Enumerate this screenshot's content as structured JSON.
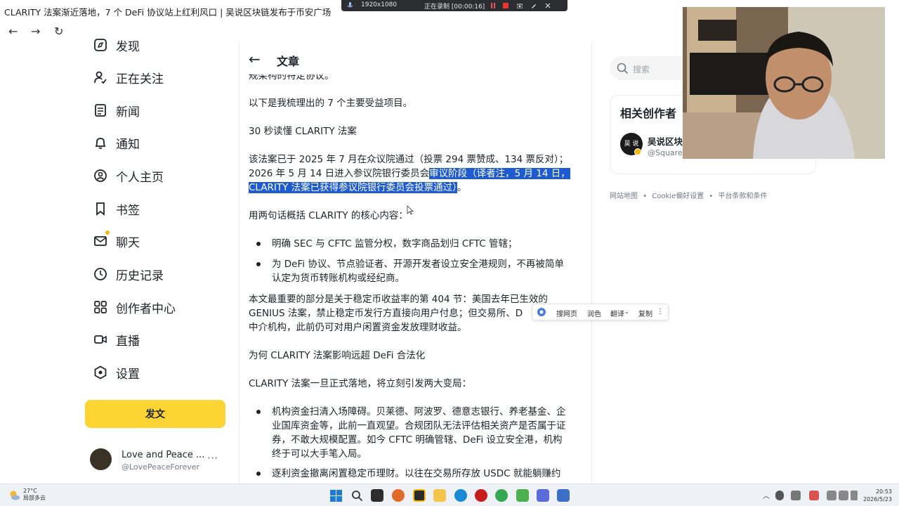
{
  "window": {
    "title": "CLARITY 法案渐近落地，7 个 DeFi 协议站上红利风口 | 吴说区块链发布于币安广场"
  },
  "recorder": {
    "resolution": "1920x1080",
    "status": "正在录制 [00:00:16]"
  },
  "sidebar": {
    "items": [
      {
        "label": "发现",
        "icon": "discover-icon"
      },
      {
        "label": "正在关注",
        "icon": "following-icon"
      },
      {
        "label": "新闻",
        "icon": "news-icon"
      },
      {
        "label": "通知",
        "icon": "bell-icon"
      },
      {
        "label": "个人主页",
        "icon": "profile-icon"
      },
      {
        "label": "书签",
        "icon": "bookmark-icon"
      },
      {
        "label": "聊天",
        "icon": "mail-icon"
      },
      {
        "label": "历史记录",
        "icon": "history-icon"
      },
      {
        "label": "创作者中心",
        "icon": "creator-center-icon"
      },
      {
        "label": "直播",
        "icon": "live-icon"
      },
      {
        "label": "设置",
        "icon": "settings-icon"
      }
    ],
    "post_button": "发文",
    "user": {
      "name": "Love and Peace ...",
      "handle": "@LovePeaceForever",
      "more": "···"
    }
  },
  "article": {
    "back": "←",
    "header_title": "文章",
    "cut_line": "规架构的特定协议。",
    "p1": "以下是我梳理出的 7 个主要受益项目。",
    "p2": "30 秒读懂 CLARITY 法案",
    "p3_line1": "该法案已于 2025 年 7 月在众议院通过（投票 294 票赞成、134 票反对）；",
    "p3_line2_plain": "2026 年 5 月 14 日进入参议院银行委员会",
    "p3_line2_hl": "审议阶段（译者注，5 月 14 日，",
    "p3_line3_hl": "CLARITY 法案已获得参议院银行委员会投票通过）",
    "p3_line3_end": "。",
    "p4": "用两句话概括 CLARITY 的核心内容：",
    "b1": "明确 SEC 与 CFTC 监管分权，数字商品划归 CFTC 管辖；",
    "b2_line1": "为 DeFi 协议、节点验证者、开源开发者设立安全港规则，不再被简单",
    "b2_line2": "认定为货币转账机构或经纪商。",
    "p5_line1": "本文最重要的部分是关于稳定币收益率的第 404 节：美国去年已生效的",
    "p5_line2": "GENIUS 法案，禁止稳定币发行方直接向用户付息；但交易所、D",
    "p5_line3": "中介机构，此前仍可对用户闲置资金发放理财收益。",
    "p6": "为何 CLARITY 法案影响远超 DeFi 合法化",
    "p7": "CLARITY 法案一旦正式落地，将立刻引发两大变局：",
    "b3_line1": "机构资金扫清入场障碍。贝莱德、阿波罗、德意志银行、养老基金、企",
    "b3_line2": "业国库资金等，此前一直观望。合规团队无法评估相关资产是否属于证",
    "b3_line3": "券，不敢大规模配置。如今 CFTC 明确管辖、DeFi 设立安全港，机构",
    "b3_line4": "终于可以大手笔入局。",
    "b4_line1": "逐利资金撤离闲置稳定币理财。以往在交易所存放 USDC 就能躺赚约"
  },
  "selection_popup": {
    "search": "搜网页",
    "polish": "润色",
    "translate": "翻译",
    "copy": "复制",
    "more": "⋮"
  },
  "right": {
    "search_placeholder": "搜索",
    "creators_title": "相关创作者",
    "creator_avatar": "吴 说",
    "creator_name": "吴说区块",
    "creator_handle": "@Square-",
    "footer": [
      "网站地图",
      "Cookie偏好设置",
      "平台条款和条件"
    ],
    "footer_sep": "•"
  },
  "taskbar": {
    "temperature": "27°C",
    "weather": "局部多云",
    "time": "20:53",
    "date": "2026/5/23"
  },
  "colors": {
    "accent": "#fcd535",
    "selection": "#1e5bd1",
    "notification_dot": "#f0b90b"
  }
}
